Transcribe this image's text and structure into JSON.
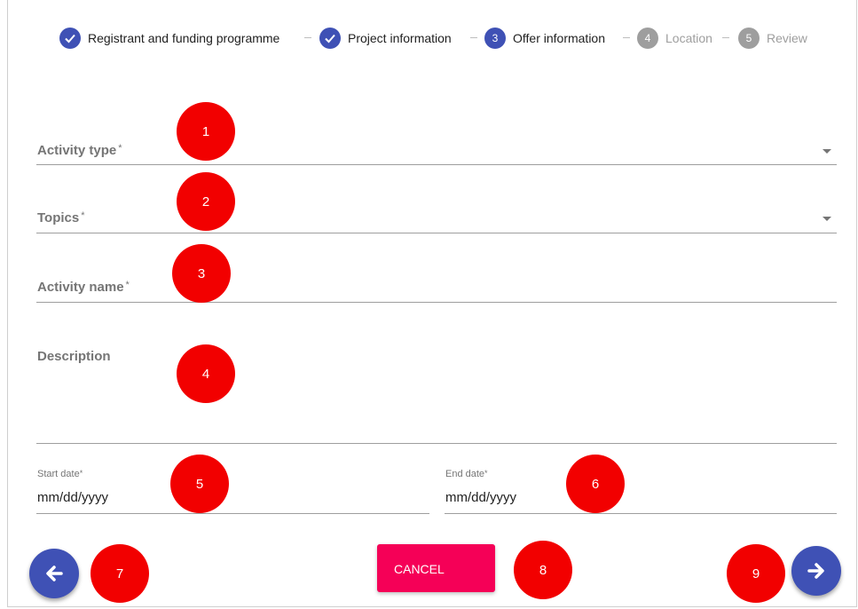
{
  "stepper": {
    "steps": [
      {
        "label": "Registrant and funding programme",
        "state": "done",
        "icon": "check-icon"
      },
      {
        "label": "Project information",
        "state": "done",
        "icon": "check-icon"
      },
      {
        "label": "Offer information",
        "state": "active",
        "number": "3"
      },
      {
        "label": "Location",
        "state": "pending",
        "number": "4"
      },
      {
        "label": "Review",
        "state": "pending",
        "number": "5"
      }
    ]
  },
  "form": {
    "activity_type": {
      "label": "Activity type",
      "required": "*"
    },
    "topics": {
      "label": "Topics",
      "required": "*"
    },
    "activity_name": {
      "label": "Activity name",
      "required": "*"
    },
    "description": {
      "label": "Description"
    },
    "start_date": {
      "label": "Start date",
      "required": "*",
      "placeholder": "mm/dd/yyyy"
    },
    "end_date": {
      "label": "End date",
      "required": "*",
      "placeholder": "mm/dd/yyyy"
    }
  },
  "actions": {
    "back_icon": "arrow-left-icon",
    "cancel_label": "CANCEL",
    "next_icon": "arrow-right-icon"
  },
  "markers": [
    "1",
    "2",
    "3",
    "4",
    "5",
    "6",
    "7",
    "8",
    "9"
  ],
  "colors": {
    "primary": "#3f51b5",
    "accent": "#f50057",
    "marker": "#f20000",
    "pending": "#9e9e9e"
  }
}
